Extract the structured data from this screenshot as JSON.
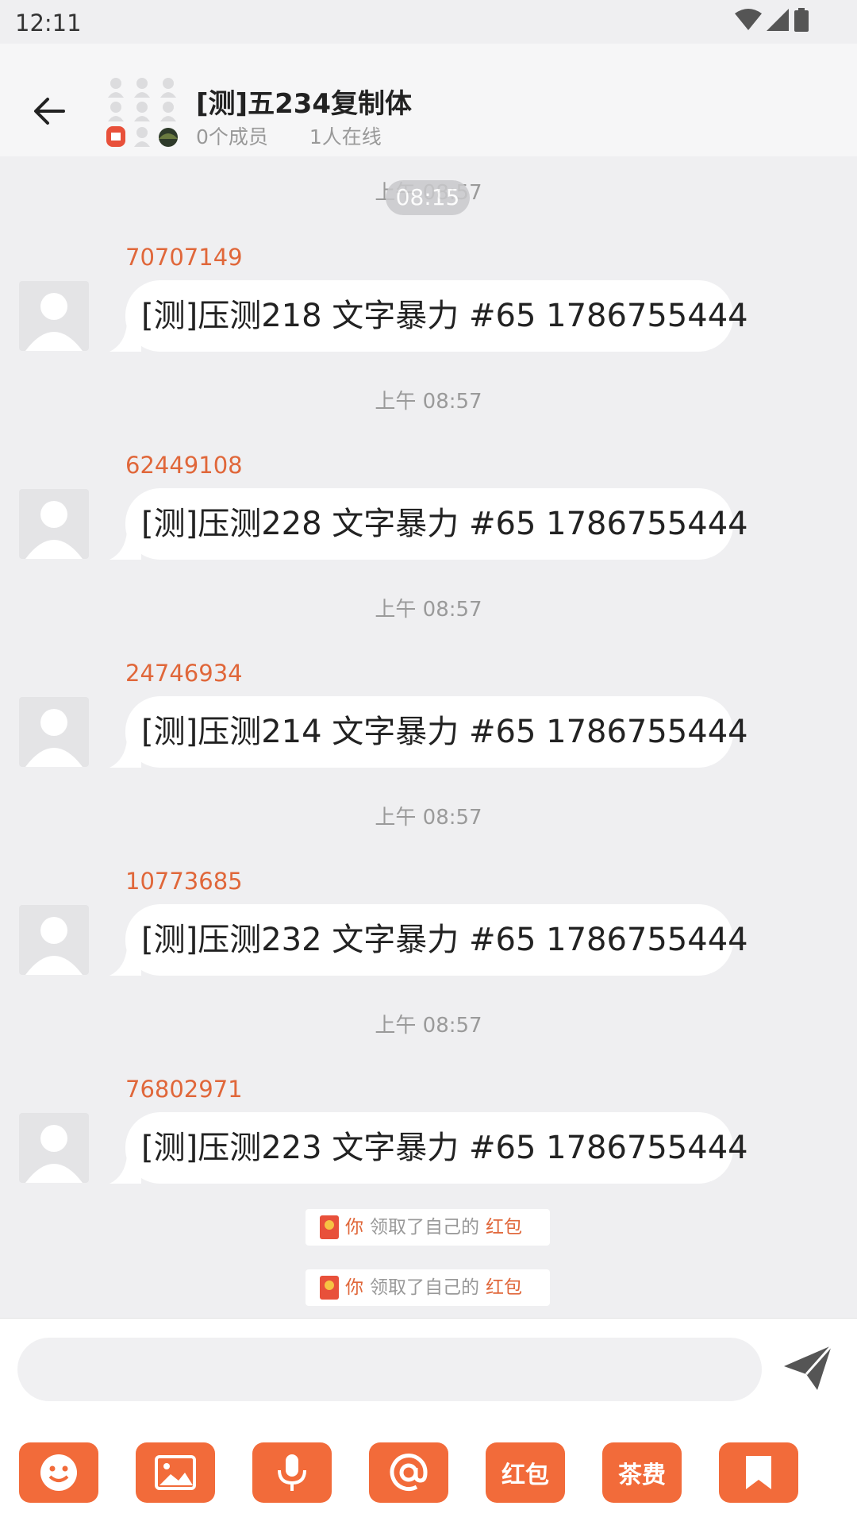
{
  "status": {
    "time": "12:11"
  },
  "header": {
    "title": "[测]五234复制体",
    "members": "0个成员",
    "online": "1人在线"
  },
  "chat": {
    "floating_time": "08:15",
    "top_time": "上午 08:57",
    "messages": [
      {
        "sender": "70707149",
        "text": "[测]压测218 文字暴力 #65 1786755444",
        "time_after": "上午 08:57"
      },
      {
        "sender": "62449108",
        "text": "[测]压测228 文字暴力 #65 1786755444",
        "time_after": "上午 08:57"
      },
      {
        "sender": "24746934",
        "text": "[测]压测214 文字暴力 #65 1786755444",
        "time_after": "上午 08:57"
      },
      {
        "sender": "10773685",
        "text": "[测]压测232 文字暴力 #65 1786755444",
        "time_after": "上午 08:57"
      },
      {
        "sender": "76802971",
        "text": "[测]压测223 文字暴力 #65 1786755444"
      }
    ],
    "notices": [
      {
        "you": "你",
        "middle": "领取了自己的",
        "hb": "红包"
      },
      {
        "you": "你",
        "middle": "领取了自己的",
        "hb": "红包"
      }
    ]
  },
  "input": {
    "placeholder": ""
  },
  "tools": {
    "redpacket_label": "红包",
    "tea_label": "茶费"
  },
  "colors": {
    "accent": "#f26b3a",
    "sender": "#e0673a",
    "background": "#efeff1"
  }
}
